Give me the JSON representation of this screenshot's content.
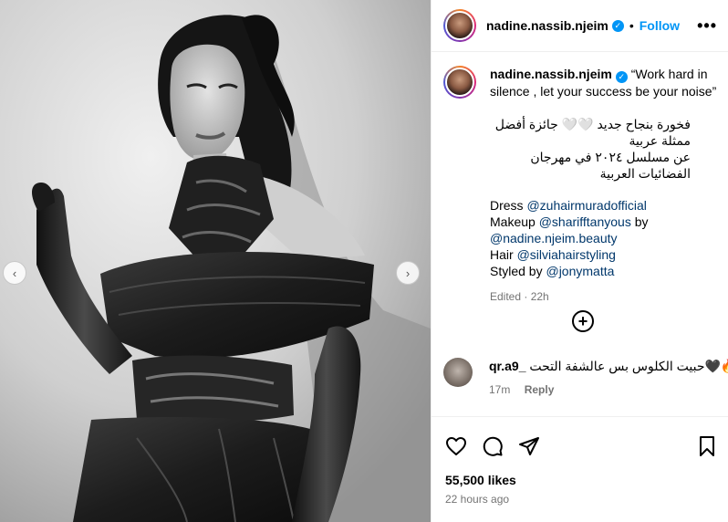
{
  "post": {
    "username": "nadine.nassib.njeim",
    "follow_label": "Follow",
    "dot": "•",
    "more": "•••"
  },
  "caption": {
    "username": "nadine.nassib.njeim",
    "quote": "“Work hard in silence , let your success be your noise”",
    "arabic_line1": "فخورة بنجاح جديد 🤍🤍 جائزة أفضل ممثلة عربية",
    "arabic_line2": "عن مسلسل ٢٠٢٤ في مهرجان الفضائيات العربية",
    "credits": [
      {
        "prefix": "Dress ",
        "mention": "@zuhairmuradofficial",
        "suffix": ""
      },
      {
        "prefix": "Makeup ",
        "mention": "@sharifftanyous",
        "suffix": " by"
      },
      {
        "prefix": "",
        "mention": "@nadine.njeim.beauty",
        "suffix": ""
      },
      {
        "prefix": "Hair ",
        "mention": "@silviahairstyling",
        "suffix": ""
      },
      {
        "prefix": "Styled by ",
        "mention": "@jonymatta",
        "suffix": ""
      }
    ],
    "edited": "Edited · 22h"
  },
  "comments": [
    {
      "username": "qr.a9_",
      "text": "حبيت الكلوس بس عالشفة التحت🖤🔥😌🔥🔥 ⁠🫶🏼",
      "time": "17m",
      "reply_label": "Reply"
    }
  ],
  "stats": {
    "likes": "55,500 likes",
    "time_ago": "22 hours ago"
  },
  "icons": {
    "like": "heart-icon",
    "comment": "comment-icon",
    "share": "share-icon",
    "save": "bookmark-icon",
    "add_comment": "plus-circle-icon",
    "prev": "chevron-left-icon",
    "next": "chevron-right-icon"
  },
  "colors": {
    "accent": "#0095f6",
    "mention": "#00376b",
    "muted": "#737373"
  }
}
